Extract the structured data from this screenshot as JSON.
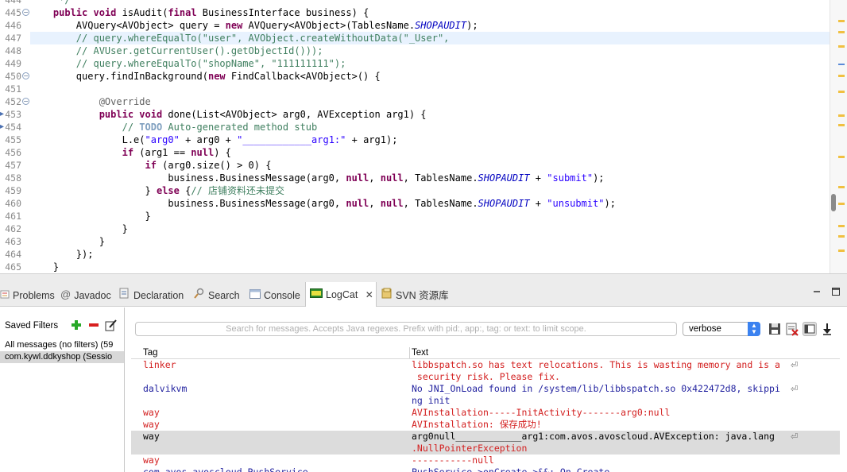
{
  "editor": {
    "lines": [
      {
        "num": "444",
        "tokens": [
          {
            "t": "     */",
            "c": "cm"
          }
        ]
      },
      {
        "num": "445",
        "fold": "−",
        "tokens": [
          {
            "t": "    ",
            "c": ""
          },
          {
            "t": "public",
            "c": "kw"
          },
          {
            "t": " ",
            "c": ""
          },
          {
            "t": "void",
            "c": "kw"
          },
          {
            "t": " isAudit(",
            "c": ""
          },
          {
            "t": "final",
            "c": "kw"
          },
          {
            "t": " BusinessInterface business) {",
            "c": ""
          }
        ]
      },
      {
        "num": "446",
        "tokens": [
          {
            "t": "        AVQuery<AVObject> query = ",
            "c": ""
          },
          {
            "t": "new",
            "c": "kw"
          },
          {
            "t": " AVQuery<AVObject>(TablesName.",
            "c": ""
          },
          {
            "t": "SHOPAUDIT",
            "c": "it"
          },
          {
            "t": ");",
            "c": ""
          }
        ]
      },
      {
        "num": "447",
        "highlight": true,
        "tokens": [
          {
            "t": "        // query.whereEqualTo(\"user\", AVObject.createWithoutData(\"_User\",",
            "c": "cm"
          }
        ]
      },
      {
        "num": "448",
        "tokens": [
          {
            "t": "        // AVUser.getCurrentUser().getObjectId()));",
            "c": "cm"
          }
        ]
      },
      {
        "num": "449",
        "tokens": [
          {
            "t": "        // query.whereEqualTo(\"shopName\", \"111111111\");",
            "c": "cm"
          }
        ]
      },
      {
        "num": "450",
        "fold": "−",
        "tokens": [
          {
            "t": "        query.findInBackground(",
            "c": ""
          },
          {
            "t": "new",
            "c": "kw"
          },
          {
            "t": " FindCallback<AVObject>() {",
            "c": ""
          }
        ]
      },
      {
        "num": "451",
        "tokens": [
          {
            "t": "",
            "c": ""
          }
        ]
      },
      {
        "num": "452",
        "fold": "−",
        "tokens": [
          {
            "t": "            @Override",
            "c": "an"
          }
        ]
      },
      {
        "num": "453",
        "tokens": [
          {
            "t": "            ",
            "c": ""
          },
          {
            "t": "public",
            "c": "kw"
          },
          {
            "t": " ",
            "c": ""
          },
          {
            "t": "void",
            "c": "kw"
          },
          {
            "t": " done(List<AVObject> arg0, AVException arg1) {",
            "c": ""
          }
        ]
      },
      {
        "num": "454",
        "tokens": [
          {
            "t": "                // ",
            "c": "cm"
          },
          {
            "t": "TODO",
            "c": "todo"
          },
          {
            "t": " Auto-generated method stub",
            "c": "cm"
          }
        ]
      },
      {
        "num": "455",
        "tokens": [
          {
            "t": "                L.e(",
            "c": ""
          },
          {
            "t": "\"arg0\"",
            "c": "st"
          },
          {
            "t": " + arg0 + ",
            "c": ""
          },
          {
            "t": "\"____________arg1:\"",
            "c": "st"
          },
          {
            "t": " + arg1);",
            "c": ""
          }
        ]
      },
      {
        "num": "456",
        "tokens": [
          {
            "t": "                ",
            "c": ""
          },
          {
            "t": "if",
            "c": "kw"
          },
          {
            "t": " (arg1 == ",
            "c": ""
          },
          {
            "t": "null",
            "c": "kw"
          },
          {
            "t": ") {",
            "c": ""
          }
        ]
      },
      {
        "num": "457",
        "tokens": [
          {
            "t": "                    ",
            "c": ""
          },
          {
            "t": "if",
            "c": "kw"
          },
          {
            "t": " (arg0.size() > 0) {",
            "c": ""
          }
        ]
      },
      {
        "num": "458",
        "tokens": [
          {
            "t": "                        business.BusinessMessage(arg0, ",
            "c": ""
          },
          {
            "t": "null",
            "c": "kw"
          },
          {
            "t": ", ",
            "c": ""
          },
          {
            "t": "null",
            "c": "kw"
          },
          {
            "t": ", TablesName.",
            "c": ""
          },
          {
            "t": "SHOPAUDIT",
            "c": "it"
          },
          {
            "t": " + ",
            "c": ""
          },
          {
            "t": "\"submit\"",
            "c": "st"
          },
          {
            "t": ");",
            "c": ""
          }
        ]
      },
      {
        "num": "459",
        "tokens": [
          {
            "t": "                    } ",
            "c": ""
          },
          {
            "t": "else",
            "c": "kw"
          },
          {
            "t": " {",
            "c": ""
          },
          {
            "t": "// 店铺资料还未提交",
            "c": "cm"
          }
        ]
      },
      {
        "num": "460",
        "tokens": [
          {
            "t": "                        business.BusinessMessage(arg0, ",
            "c": ""
          },
          {
            "t": "null",
            "c": "kw"
          },
          {
            "t": ", ",
            "c": ""
          },
          {
            "t": "null",
            "c": "kw"
          },
          {
            "t": ", TablesName.",
            "c": ""
          },
          {
            "t": "SHOPAUDIT",
            "c": "it"
          },
          {
            "t": " + ",
            "c": ""
          },
          {
            "t": "\"unsubmit\"",
            "c": "st"
          },
          {
            "t": ");",
            "c": ""
          }
        ]
      },
      {
        "num": "461",
        "tokens": [
          {
            "t": "                    }",
            "c": ""
          }
        ]
      },
      {
        "num": "462",
        "tokens": [
          {
            "t": "                }",
            "c": ""
          }
        ]
      },
      {
        "num": "463",
        "tokens": [
          {
            "t": "            }",
            "c": ""
          }
        ]
      },
      {
        "num": "464",
        "tokens": [
          {
            "t": "        });",
            "c": ""
          }
        ]
      },
      {
        "num": "465",
        "tokens": [
          {
            "t": "    }",
            "c": ""
          }
        ]
      }
    ]
  },
  "tabs": [
    {
      "label": "Problems",
      "icon": "problems-icon"
    },
    {
      "label": "Javadoc",
      "icon": "javadoc-icon"
    },
    {
      "label": "Declaration",
      "icon": "declaration-icon"
    },
    {
      "label": "Search",
      "icon": "search-icon"
    },
    {
      "label": "Console",
      "icon": "console-icon"
    },
    {
      "label": "LogCat",
      "icon": "logcat-icon",
      "active": true
    },
    {
      "label": "SVN 资源库",
      "icon": "svn-icon"
    }
  ],
  "logcat": {
    "saved_filters_label": "Saved Filters",
    "filters": [
      {
        "label": "All messages (no filters) (59"
      },
      {
        "label": "com.kywl.ddkyshop (Sessio",
        "selected": true
      }
    ],
    "search_placeholder": "Search for messages. Accepts Java regexes. Prefix with pid:, app:, tag: or text: to limit scope.",
    "level": "verbose",
    "columns": {
      "tag": "Tag",
      "text": "Text"
    },
    "rows": [
      {
        "tag": "linker",
        "text": "libbspatch.so has text relocations. This is wasting memory and is a\n security risk. Please fix.",
        "color": "#d32020",
        "wrap": true
      },
      {
        "tag": "dalvikvm",
        "text": "No JNI_OnLoad found in /system/lib/libbspatch.so 0x422472d8, skippi\nng init",
        "color": "#1f1f9e",
        "wrap": true
      },
      {
        "tag": "way",
        "text": "AVInstallation-----InitActivity-------arg0:null",
        "color": "#d32020"
      },
      {
        "tag": "way",
        "text": "AVInstallation: 保存成功!",
        "color": "#d32020"
      },
      {
        "tag": "way",
        "text": "arg0null____________arg1:com.avos.avoscloud.AVException: java.lang\n.NullPointerException",
        "color": "#000000",
        "wrap": true,
        "selected": true,
        "text_color_second": "#d32020"
      },
      {
        "tag": "way",
        "text": "-----------null",
        "color": "#d32020"
      },
      {
        "tag": "com.avos.avoscloud.PushService",
        "text": "PushService->onCreate->&&: On Create",
        "color": "#1f1f9e"
      }
    ]
  }
}
